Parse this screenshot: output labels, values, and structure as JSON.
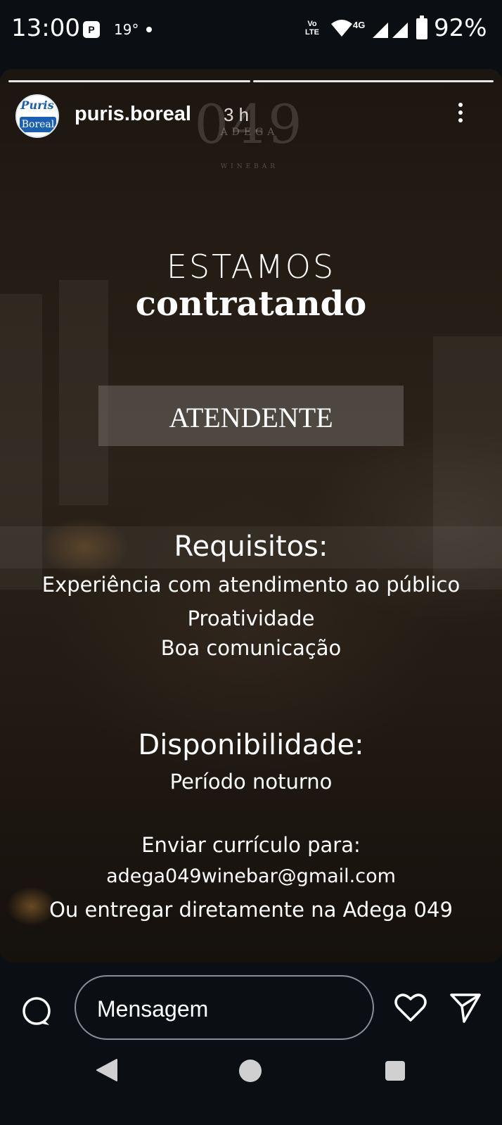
{
  "status_bar": {
    "time": "13:00",
    "notification_badge": "P",
    "temperature": "19°",
    "volte_top": "Vo",
    "volte_bottom": "LTE",
    "network_type": "4G",
    "battery_percent": "92%",
    "icons": [
      "pi-icon",
      "wifi-icon",
      "signal-icon",
      "signal-icon",
      "battery-icon"
    ]
  },
  "story": {
    "progress_segments": 2,
    "account": {
      "username": "puris.boreal",
      "time_ago": "3 h",
      "avatar_text_top": "Puris",
      "avatar_text_bottom": "Boreal"
    },
    "logo": {
      "number": "049",
      "name": "ADEGA",
      "subtitle": "WINEBAR"
    },
    "headline_light": "ESTAMOS",
    "headline_bold": "contratando",
    "role": "ATENDENTE",
    "requirements": {
      "title": "Requisitos:",
      "items": [
        "Experiência com atendimento ao público",
        "Proatividade",
        "Boa comunicação"
      ]
    },
    "availability": {
      "title": "Disponibilidade:",
      "value": "Período noturno"
    },
    "contact": {
      "title": "Enviar currículo para:",
      "email": "adega049winebar@gmail.com",
      "alternative": "Ou entregar diretamente na Adega 049"
    }
  },
  "reply_bar": {
    "placeholder": "Mensagem"
  },
  "nav_bar": {
    "icons": [
      "back-icon",
      "home-icon",
      "recents-icon"
    ]
  }
}
